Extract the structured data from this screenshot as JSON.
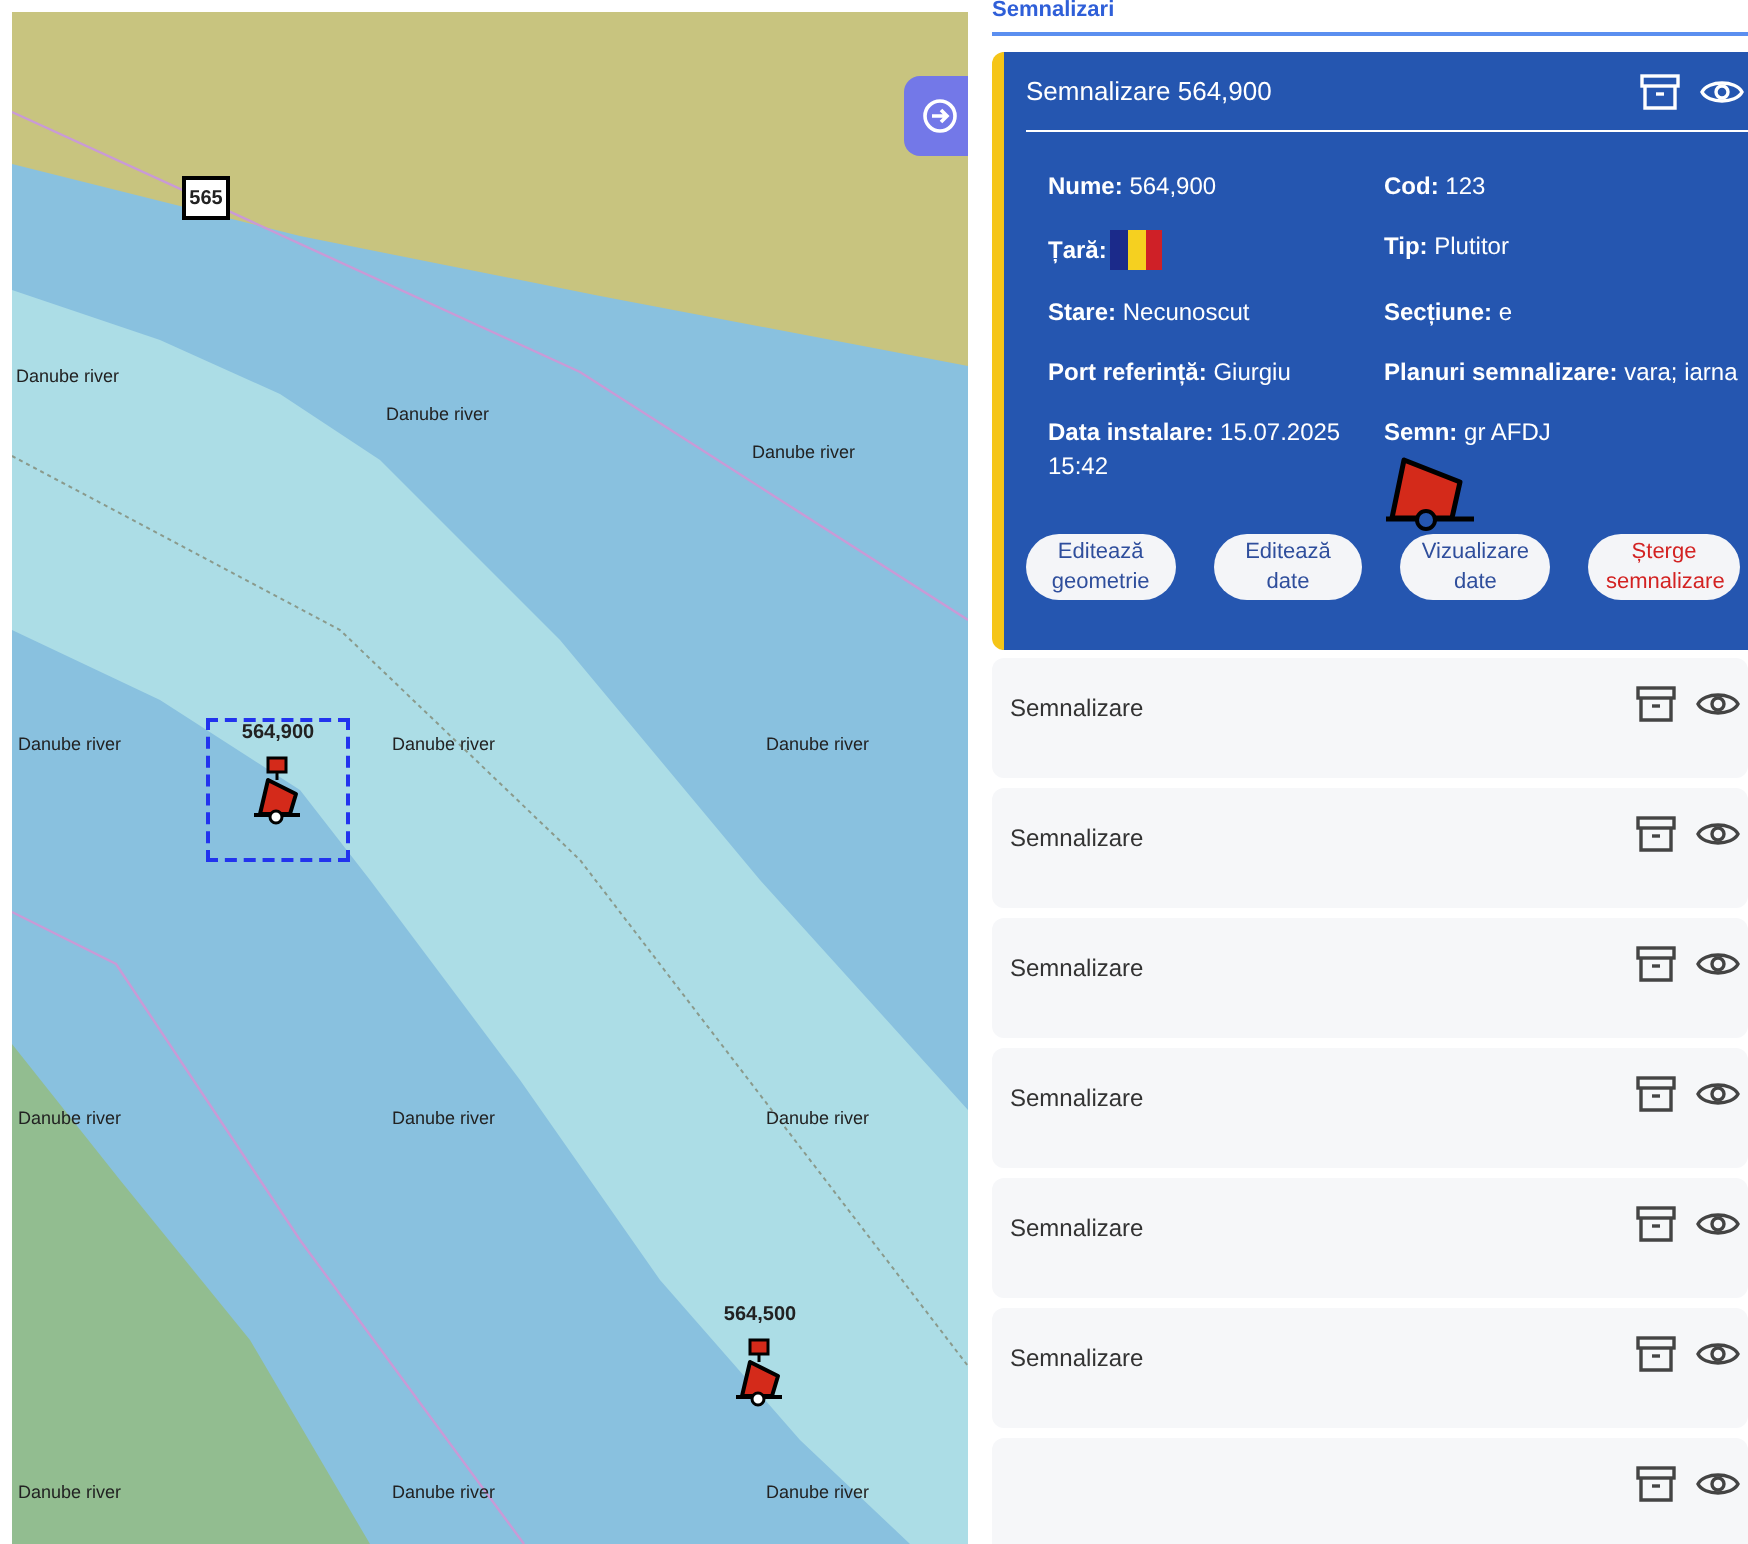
{
  "map": {
    "marker": "565",
    "labels": [
      "Danube river",
      "Danube river",
      "Danube river",
      "Danube river",
      "Danube river",
      "Danube river",
      "Danube river",
      "Danube river",
      "Danube river",
      "Danube river",
      "Danube river",
      "Danube river"
    ],
    "buoys": [
      {
        "label": "564,900",
        "selected": true
      },
      {
        "label": "564,500",
        "selected": false
      }
    ]
  },
  "panel": {
    "title": "Semnalizari"
  },
  "detail": {
    "title": "Semnalizare 564,900",
    "fields": [
      {
        "label": "Nume:",
        "value": "564,900",
        "kind": "text"
      },
      {
        "label": "Cod:",
        "value": "123",
        "kind": "text"
      },
      {
        "label": "Țară:",
        "kind": "flag"
      },
      {
        "label": "Tip:",
        "value": "Plutitor",
        "kind": "text"
      },
      {
        "label": "Stare:",
        "value": "Necunoscut",
        "kind": "text"
      },
      {
        "label": "Secțiune:",
        "value": "e",
        "kind": "text"
      },
      {
        "label": "Port referință:",
        "value": "Giurgiu",
        "kind": "text"
      },
      {
        "label": "Planuri semnalizare:",
        "value": "vara; iarna",
        "kind": "text"
      },
      {
        "label": "Data instalare:",
        "value": "15.07.2025 15:42",
        "kind": "text"
      },
      {
        "label": "Semn:",
        "value": "gr AFDJ",
        "kind": "symbol"
      }
    ],
    "actions": [
      {
        "label": "Editează geometrie",
        "kind": "normal"
      },
      {
        "label": "Editează date",
        "kind": "normal"
      },
      {
        "label": "Vizualizare date",
        "kind": "normal"
      },
      {
        "label": "Șterge semnalizare",
        "kind": "danger"
      }
    ]
  },
  "items": [
    {
      "title": "Semnalizare"
    },
    {
      "title": "Semnalizare"
    },
    {
      "title": "Semnalizare"
    },
    {
      "title": "Semnalizare"
    },
    {
      "title": "Semnalizare"
    },
    {
      "title": "Semnalizare"
    }
  ]
}
